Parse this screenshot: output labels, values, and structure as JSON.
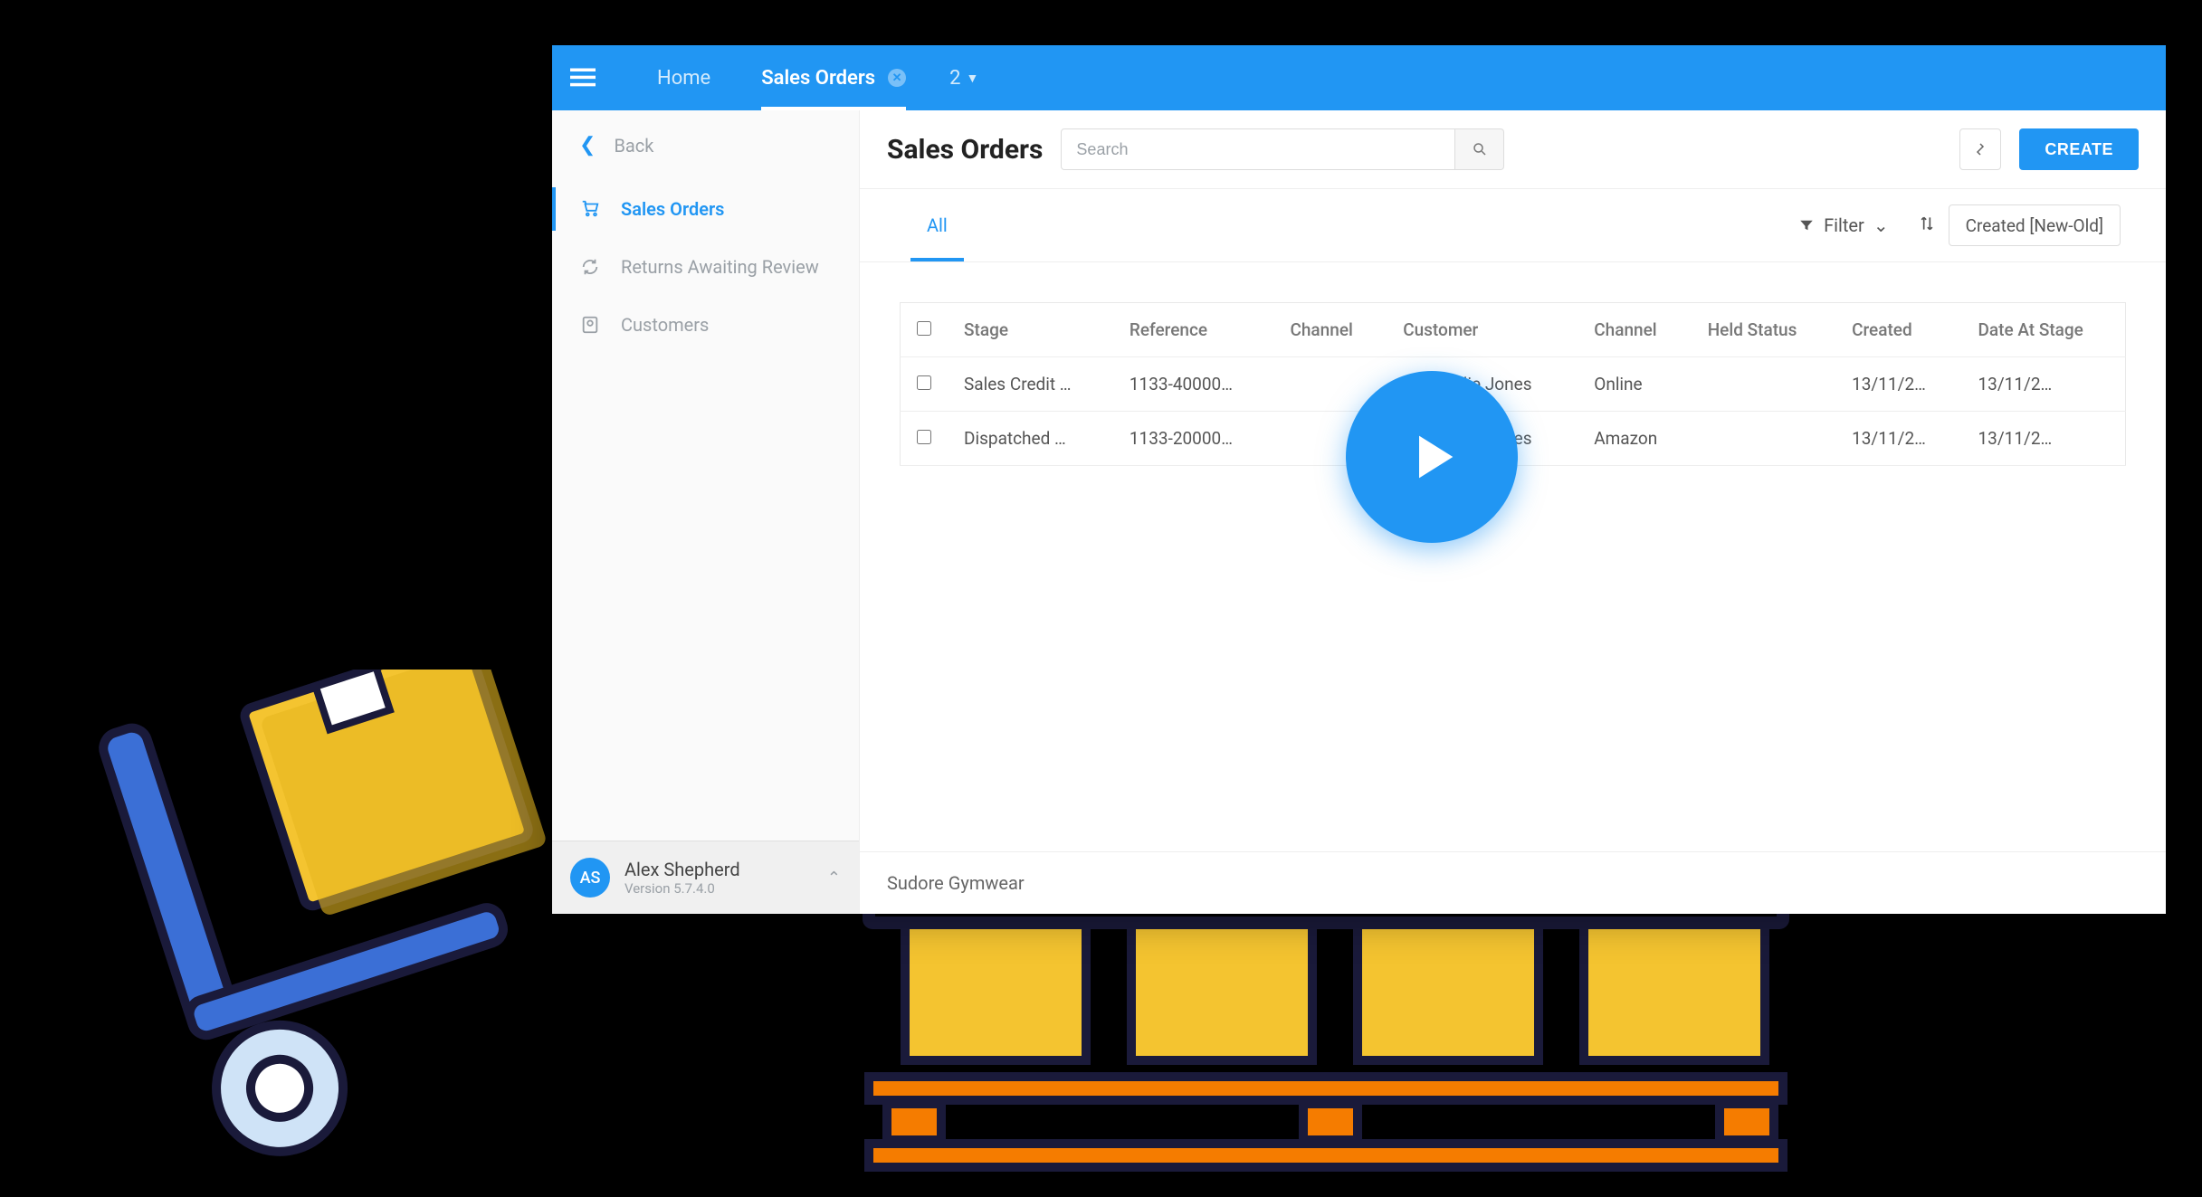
{
  "topbar": {
    "tabs": [
      {
        "label": "Home"
      },
      {
        "label": "Sales Orders",
        "closeable": true
      }
    ],
    "badge": "2"
  },
  "sidebar": {
    "back_label": "Back",
    "items": [
      {
        "label": "Sales Orders",
        "icon": "cart-icon"
      },
      {
        "label": "Returns Awaiting Review",
        "icon": "refresh-icon"
      },
      {
        "label": "Customers",
        "icon": "person-icon"
      }
    ],
    "user": {
      "initials": "AS",
      "name": "Alex Shepherd",
      "version": "Version 5.7.4.0"
    }
  },
  "page": {
    "title": "Sales Orders",
    "search_placeholder": "Search",
    "create_label": "CREATE",
    "list_tabs": [
      {
        "label": "All"
      }
    ],
    "filter_label": "Filter",
    "sort_label": "Created [New-Old]"
  },
  "table": {
    "headers": [
      "Stage",
      "Reference",
      "Channel",
      "Customer",
      "Channel",
      "Held Status",
      "Created",
      "Date At Stage"
    ],
    "rows": [
      {
        "stage": "Sales Credit …",
        "reference": "1133-40000…",
        "channel_ref": "",
        "customer": "Miss Billie Jones",
        "channel": "Online",
        "held": "",
        "created": "13/11/2…",
        "date_at_stage": "13/11/2…"
      },
      {
        "stage": "Dispatched …",
        "reference": "1133-20000…",
        "channel_ref": "",
        "customer": "Miss Billie Jones",
        "channel": "Amazon",
        "held": "",
        "created": "13/11/2…",
        "date_at_stage": "13/11/2…"
      }
    ]
  },
  "footer": {
    "company": "Sudore Gymwear"
  }
}
